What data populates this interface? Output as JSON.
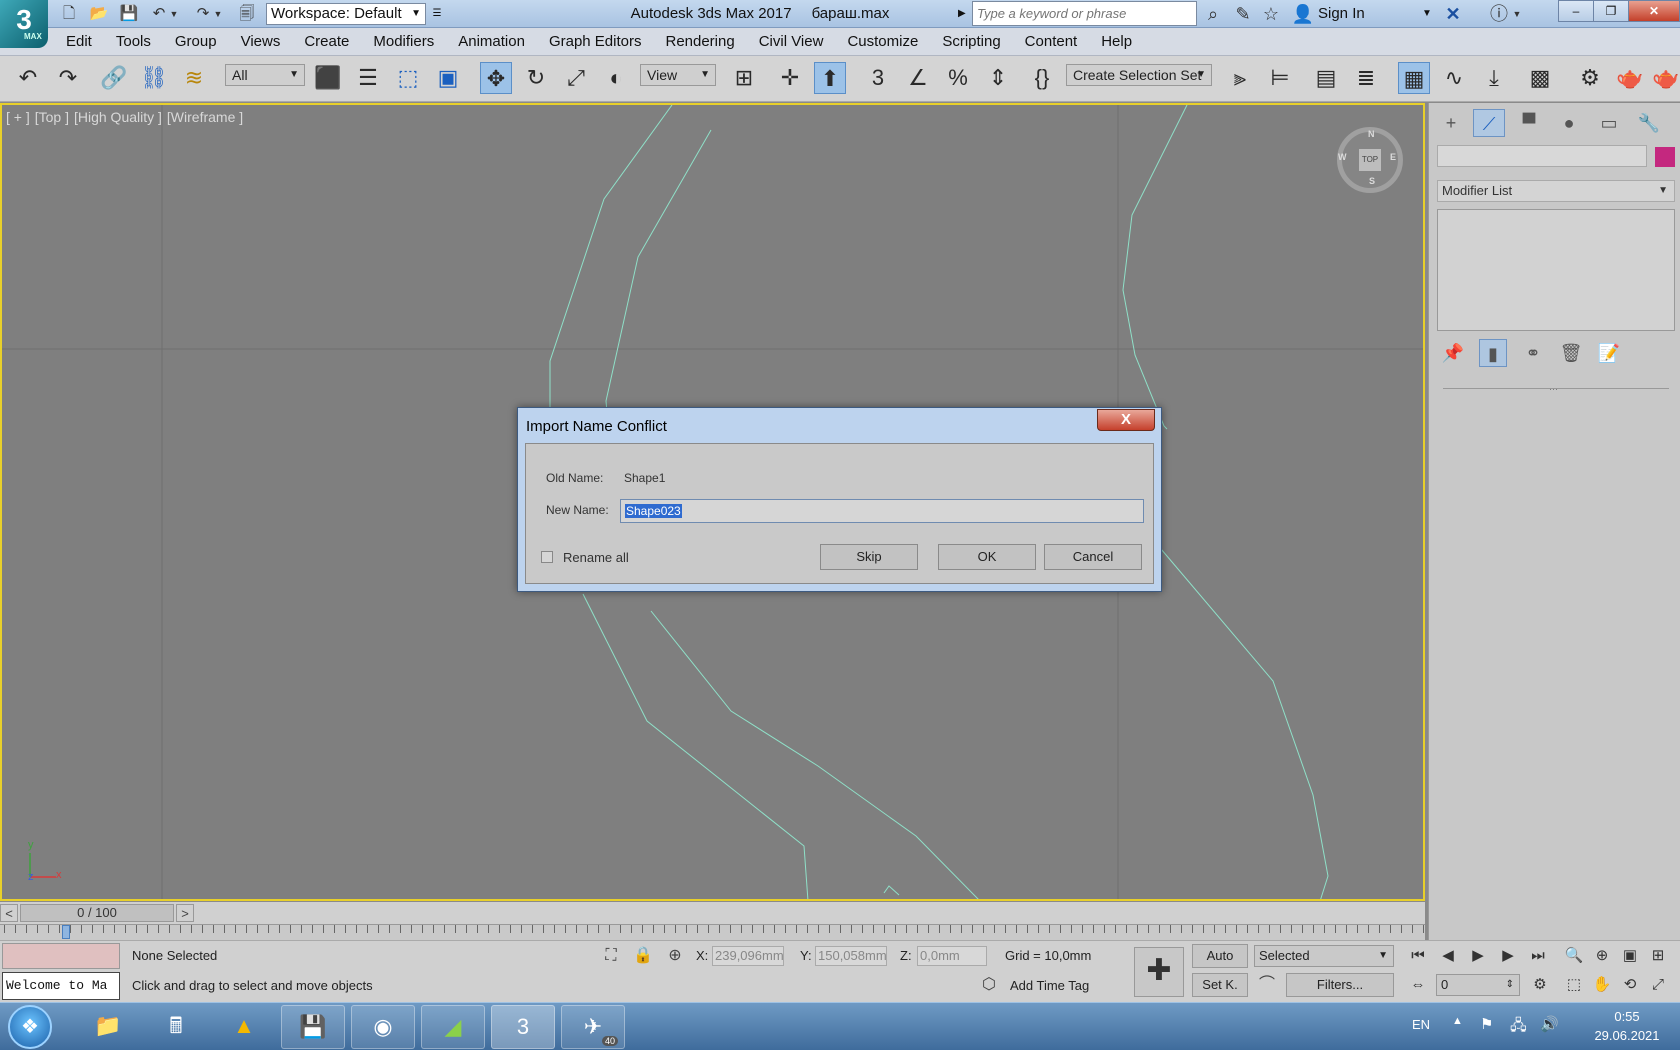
{
  "app": {
    "logo_text": "3",
    "logo_sub": "MAX",
    "title": "Autodesk 3ds Max 2017",
    "file": "барaш.max"
  },
  "quick_access": {
    "workspace": "Workspace: Default"
  },
  "search": {
    "placeholder": "Type a keyword or phrase"
  },
  "account": {
    "sign_in": "Sign In"
  },
  "menu": {
    "items": [
      "Edit",
      "Tools",
      "Group",
      "Views",
      "Create",
      "Modifiers",
      "Animation",
      "Graph Editors",
      "Rendering",
      "Civil View",
      "Customize",
      "Scripting",
      "Content",
      "Help"
    ]
  },
  "toolbar": {
    "filter": "All",
    "ref_coord": "View",
    "selection_set": "Create Selection Set"
  },
  "viewport": {
    "labels": [
      "[ + ]",
      "[Top ]",
      "[High Quality ]",
      "[Wireframe ]"
    ],
    "viewcube_face": "TOP",
    "compass": {
      "n": "N",
      "s": "S",
      "e": "E",
      "w": "W"
    },
    "axis_x": "x",
    "axis_y": "y",
    "axis_z": "z",
    "wire_color": "#8fe0c8"
  },
  "timeline": {
    "frame": "0 / 100",
    "prev": "<",
    "next": ">"
  },
  "command_panel": {
    "modifier_list": "Modifier List",
    "object_color": "#c4287f"
  },
  "status": {
    "listener_text": "Welcome to Ma",
    "selection": "None Selected",
    "prompt": "Click and drag to select and move objects",
    "x_label": "X:",
    "x_value": "239,096mm",
    "y_label": "Y:",
    "y_value": "150,058mm",
    "z_label": "Z:",
    "z_value": "0,0mm",
    "grid": "Grid = 10,0mm",
    "add_time_tag": "Add Time Tag",
    "auto_key": "Auto",
    "set_key": "Set K.",
    "key_mode": "Selected",
    "filters": "Filters...",
    "frame_spinner": "0"
  },
  "taskbar": {
    "telegram_badge": "40",
    "language": "EN",
    "time": "0:55",
    "date": "29.06.2021"
  },
  "dialog": {
    "title": "Import Name Conflict",
    "close": "X",
    "old_name_label": "Old Name:",
    "old_name_value": "Shape1",
    "new_name_label": "New Name:",
    "new_name_value": "Shape023",
    "rename_all": "Rename all",
    "skip": "Skip",
    "ok": "OK",
    "cancel": "Cancel"
  }
}
